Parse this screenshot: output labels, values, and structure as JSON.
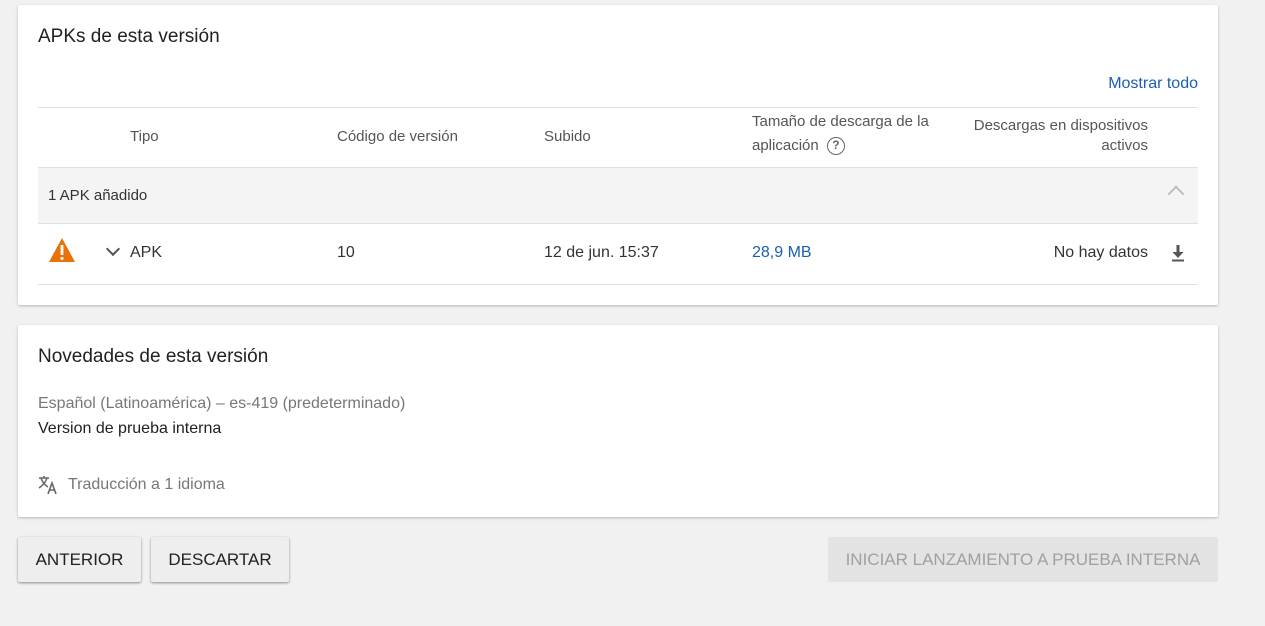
{
  "apk_card": {
    "title": "APKs de esta versión",
    "show_all": "Mostrar todo",
    "columns": {
      "tipo": "Tipo",
      "codigo": "Código de versión",
      "subido": "Subido",
      "tamano_line1": "Tamaño de descarga de la",
      "tamano_line2": "aplicación",
      "descargas_line1": "Descargas en dispositivos",
      "descargas_line2": "activos"
    },
    "help_icon": "?",
    "group_label": "1 APK añadido",
    "rows": [
      {
        "tipo": "APK",
        "codigo": "10",
        "subido": "12 de jun. 15:37",
        "tamano": "28,9 MB",
        "descargas": "No hay datos"
      }
    ]
  },
  "news_card": {
    "title": "Novedades de esta versión",
    "language": "Español (Latinoamérica) – es-419 (predeterminado)",
    "notes": "Version de prueba interna",
    "translation": "Traducción a 1 idioma"
  },
  "buttons": {
    "previous": "ANTERIOR",
    "discard": "DESCARTAR",
    "launch": "INICIAR LANZAMIENTO A PRUEBA INTERNA"
  },
  "colors": {
    "link": "#1c5fae",
    "warning": "#e8710a"
  },
  "icons": [
    "warning-icon",
    "chevron-down-icon",
    "chevron-up-icon",
    "download-icon",
    "help-icon",
    "translate-icon"
  ]
}
